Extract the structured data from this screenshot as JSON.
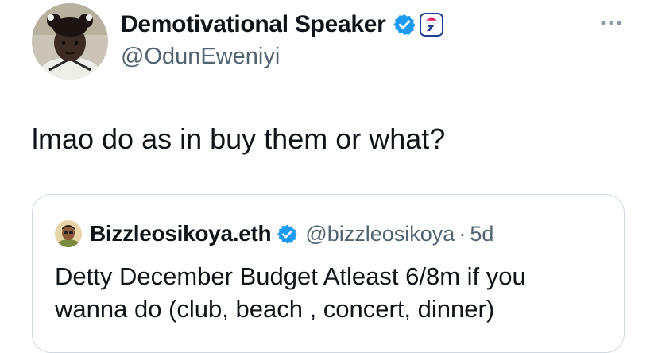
{
  "tweet": {
    "author_name": "Demotivational Speaker",
    "author_handle": "@OdunEweniyi",
    "text": "lmao do as in buy them or what?",
    "icons": {
      "avatar": "child-photo-avatar",
      "verified": "verified-badge-icon",
      "affiliate": "affiliate-badge-icon",
      "more": "more-options-icon"
    }
  },
  "quote": {
    "author_name": "Bizzleosikoya.eth",
    "author_handle": "@bizzleosikoya",
    "separator": "·",
    "time": "5d",
    "text_lines": [
      "Detty December Budget Atleast 6/8m if you",
      "wanna do (club, beach , concert, dinner)"
    ]
  },
  "colors": {
    "verified_blue": "#1d9bf0",
    "text_primary": "#0f1419",
    "text_secondary": "#536471",
    "border": "#cfd9de",
    "affiliate_navy": "#1f3f8f",
    "affiliate_red": "#e0245e"
  }
}
